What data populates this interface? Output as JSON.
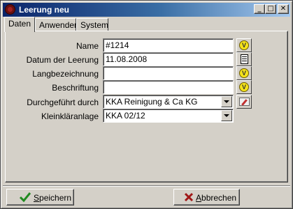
{
  "window": {
    "title": "Leerung neu",
    "controls": {
      "minimize": "_",
      "maximize": "□",
      "close": "✕"
    }
  },
  "tabs": [
    {
      "label": "Daten",
      "active": true
    },
    {
      "label": "Anwender",
      "active": false
    },
    {
      "label": "System",
      "active": false
    }
  ],
  "form": {
    "name": {
      "label": "Name",
      "value": "#1214"
    },
    "datum": {
      "label": "Datum der Leerung",
      "value": "11.08.2008"
    },
    "langbezeichnung": {
      "label": "Langbezeichnung",
      "value": ""
    },
    "beschriftung": {
      "label": "Beschriftung",
      "value": ""
    },
    "durchgefuehrt": {
      "label": "Durchgeführt durch",
      "value": "KKA Reinigung & Ca KG"
    },
    "kleinklaeranlage": {
      "label": "Kleinkläranlage",
      "value": "KKA 02/12"
    }
  },
  "icons": {
    "v_letter": "V"
  },
  "footer": {
    "save": {
      "label_first": "S",
      "label_rest": "peichern"
    },
    "cancel": {
      "label_first": "A",
      "label_rest": "bbrechen"
    }
  },
  "colors": {
    "titlebar_start": "#0a246a",
    "titlebar_end": "#a6caf0",
    "face": "#d4d0c8",
    "check_green": "#1f8a1f",
    "cancel_red": "#a01818",
    "v_yellow": "#f4e21a"
  }
}
